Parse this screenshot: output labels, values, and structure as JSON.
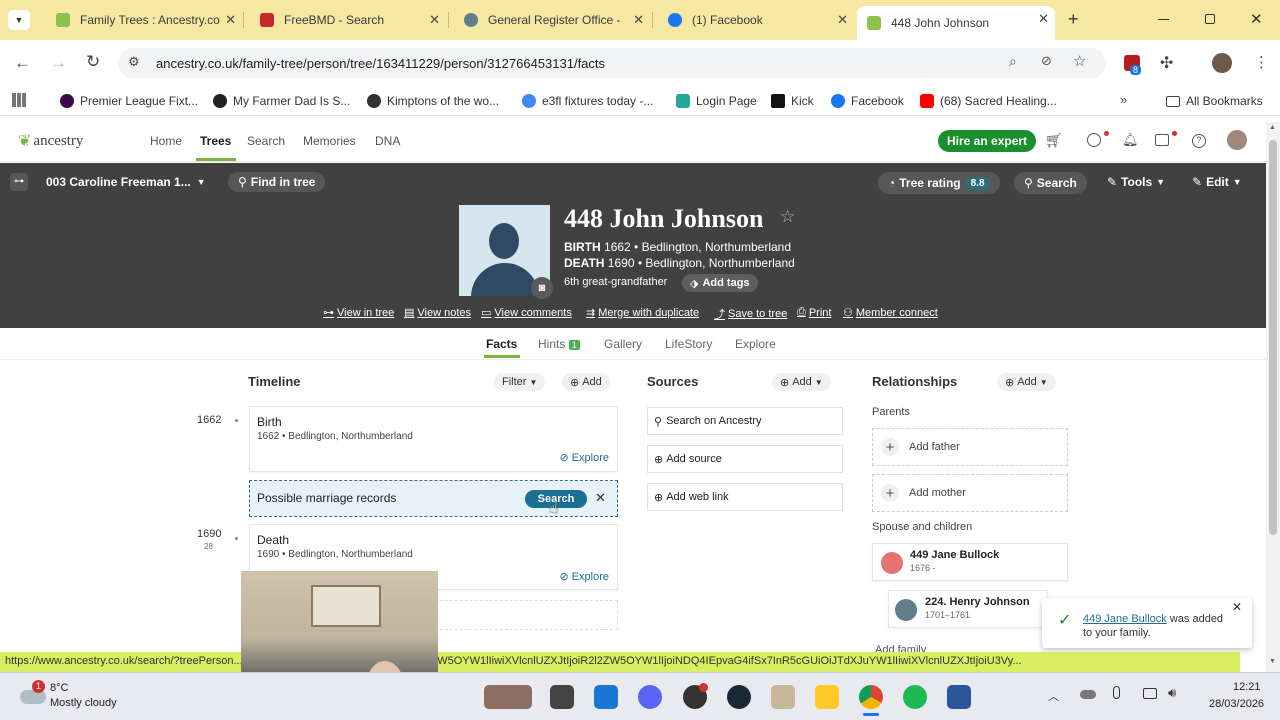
{
  "browser": {
    "tabs": [
      {
        "title": "Family Trees : Ancestry.co",
        "color": "#8bc34a"
      },
      {
        "title": "FreeBMD - Search",
        "color": "#c62828"
      },
      {
        "title": "General Register Office -",
        "color": "#607d8b"
      },
      {
        "title": "(1) Facebook",
        "color": "#1877f2"
      },
      {
        "title": "448 John Johnson",
        "color": "#8bc34a"
      }
    ],
    "new_tab": "+",
    "url": "ancestry.co.uk/family-tree/person/tree/163411229/person/312766453131/facts",
    "extension_badge": "8",
    "bookmarks": [
      {
        "label": "Premier League Fixt...",
        "color": "#3d0a49"
      },
      {
        "label": "My Farmer Dad Is S...",
        "color": "#222222"
      },
      {
        "label": "Kimptons of the wo...",
        "color": "#333333"
      },
      {
        "label": "e3fl fixtures today -...",
        "color": "#4285f4"
      },
      {
        "label": "Login Page",
        "color": "#26a69a"
      },
      {
        "label": "Kick",
        "color": "#111111"
      },
      {
        "label": "Facebook",
        "color": "#1877f2"
      },
      {
        "label": "(68) Sacred Healing...",
        "color": "#ff0000"
      }
    ],
    "all_bookmarks": "All Bookmarks"
  },
  "ancestry": {
    "logo": "ancestry",
    "nav": [
      "Home",
      "Trees",
      "Search",
      "Memories",
      "DNA"
    ],
    "hire_expert": "Hire an expert",
    "tree_name": "003 Caroline Freeman 1...",
    "find_in_tree": "Find in tree",
    "tree_rating_label": "Tree rating",
    "tree_rating_value": "8.8",
    "search_btn": "Search",
    "tools_btn": "Tools",
    "edit_btn": "Edit",
    "person": {
      "name": "448 John Johnson",
      "birth_label": "BIRTH",
      "birth_value": "1662 • Bedlington, Northumberland",
      "death_label": "DEATH",
      "death_value": "1690 • Bedlington, Northumberland",
      "relation": "6th great-grandfather",
      "add_tags": "Add tags"
    },
    "actions": [
      "View in tree",
      "View notes",
      "View comments",
      "Merge with duplicate",
      "Save to tree",
      "Print",
      "Member connect"
    ],
    "subtabs": {
      "facts": "Facts",
      "hints": "Hints",
      "hints_count": "1",
      "gallery": "Gallery",
      "lifestory": "LifeStory",
      "explore": "Explore"
    },
    "timeline": {
      "title": "Timeline",
      "filter": "Filter",
      "add": "Add",
      "events": [
        {
          "year": "1662",
          "title": "Birth",
          "detail": "1662 • Bedlington, Northumberland",
          "explore": "Explore"
        },
        {
          "year": "1690",
          "age": "28",
          "title": "Death",
          "detail": "1690 • Bedlington, Northumberland",
          "explore": "Explore"
        }
      ],
      "marriage_prompt": "Possible marriage records",
      "marriage_search": "Search"
    },
    "sources": {
      "title": "Sources",
      "add": "Add",
      "items": [
        "Search on Ancestry",
        "Add source",
        "Add web link"
      ]
    },
    "relationships": {
      "title": "Relationships",
      "add": "Add",
      "parents_label": "Parents",
      "add_father": "Add father",
      "add_mother": "Add mother",
      "spouse_label": "Spouse and children",
      "spouse_name": "449 Jane Bullock",
      "spouse_years": "1676 -",
      "child_name": "224. Henry Johnson",
      "child_years": "1701–1761",
      "add_family": "Add family"
    },
    "toast": {
      "link": "449 Jane Bullock",
      "text": "was added to your family."
    }
  },
  "status_url": "https://www.ancestry.co.uk/search/?treePerson...RdWVyeVRIcm1zljpbeyJ0eXBlIjoiR2l2ZW5OYW1lIiwiXVlcnlUZXJtIjoiR2l2ZW5OYW1lIjoiNDQ4IEpvaG4ifSx7InR5cGUiOiJTdXJuYW1lIiwiXVlcnlUZXJtIjoiU3Vy...",
  "taskbar": {
    "weather_temp": "8°C",
    "weather_desc": "Mostly cloudy",
    "weather_alert": "1",
    "time": "12:21",
    "date": "28/03/2026"
  }
}
